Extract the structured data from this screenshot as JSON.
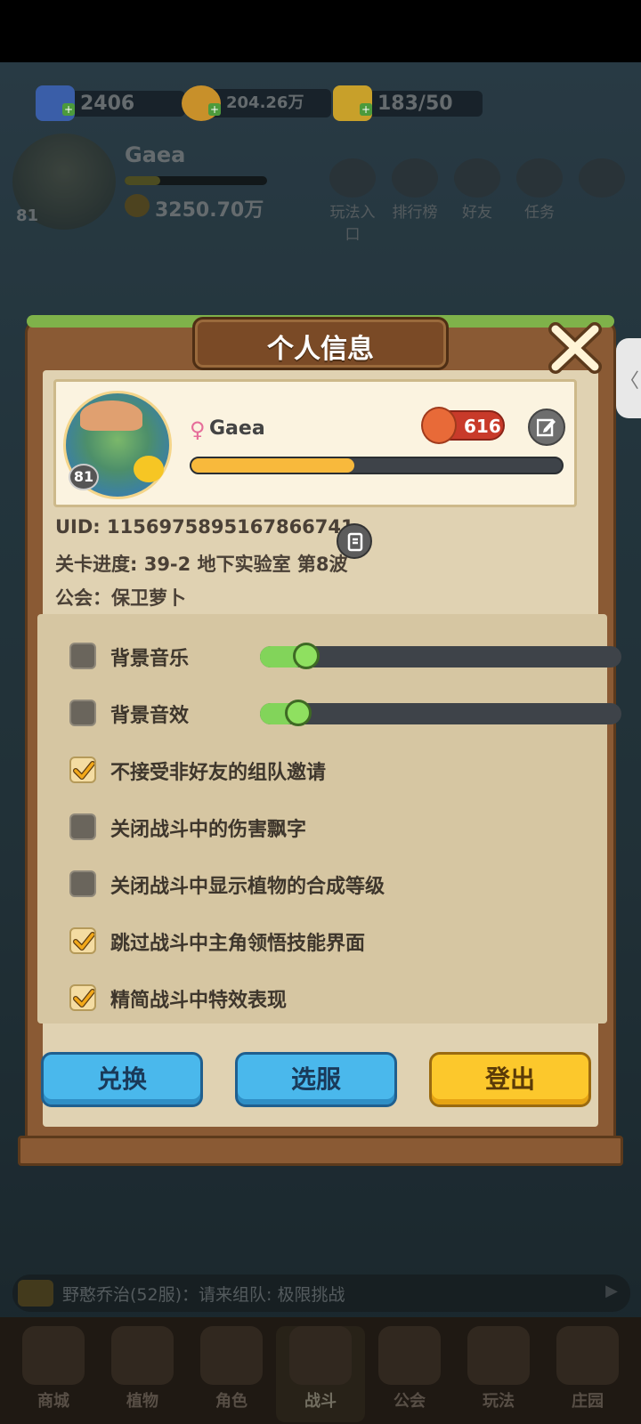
{
  "resources": [
    {
      "name": "diamond-icon",
      "value": "2406",
      "color": "#3a5ea8"
    },
    {
      "name": "coin-icon",
      "value": "204.26万",
      "color": "#c8902a"
    },
    {
      "name": "energy-icon",
      "value": "183/50",
      "color": "#c8a02a"
    }
  ],
  "player": {
    "name": "Gaea",
    "level": "81",
    "coins": "3250.70万"
  },
  "top_nav": [
    {
      "label": "玩法入口",
      "icon": "gamepad-icon"
    },
    {
      "label": "排行榜",
      "icon": "chart-icon"
    },
    {
      "label": "好友",
      "icon": "friends-icon"
    },
    {
      "label": "任务",
      "icon": "tasks-icon"
    },
    {
      "label": "",
      "icon": "more-icon"
    }
  ],
  "chat": {
    "text": "野憨乔治(52服)：请来组队: 极限挑战"
  },
  "bottom_nav": [
    {
      "label": "商城",
      "icon": "shop-icon"
    },
    {
      "label": "植物",
      "icon": "plant-icon"
    },
    {
      "label": "角色",
      "icon": "character-icon"
    },
    {
      "label": "战斗",
      "icon": "battle-icon",
      "active": true
    },
    {
      "label": "公会",
      "icon": "guild-icon"
    },
    {
      "label": "玩法",
      "icon": "play-icon"
    },
    {
      "label": "庄园",
      "icon": "manor-icon"
    }
  ],
  "modal": {
    "title": "个人信息",
    "profile": {
      "name": "Gaea",
      "level": "81",
      "likes": "616",
      "exp_progress": 0.44
    },
    "uid": "UID: 1156975895167866741",
    "stage": "关卡进度: 39-2  地下实验室 第8波",
    "guild": "公会：保卫萝卜",
    "options": [
      {
        "label": "背景音乐",
        "checked": false,
        "slider": 0.09
      },
      {
        "label": "背景音效",
        "checked": false,
        "slider": 0.07
      },
      {
        "label": "不接受非好友的组队邀请",
        "checked": true
      },
      {
        "label": "关闭战斗中的伤害飘字",
        "checked": false
      },
      {
        "label": "关闭战斗中显示植物的合成等级",
        "checked": false
      },
      {
        "label": "跳过战斗中主角领悟技能界面",
        "checked": true
      },
      {
        "label": "精简战斗中特效表现",
        "checked": true
      }
    ],
    "buttons": {
      "exchange": "兑换",
      "select_server": "选服",
      "logout": "登出"
    }
  }
}
